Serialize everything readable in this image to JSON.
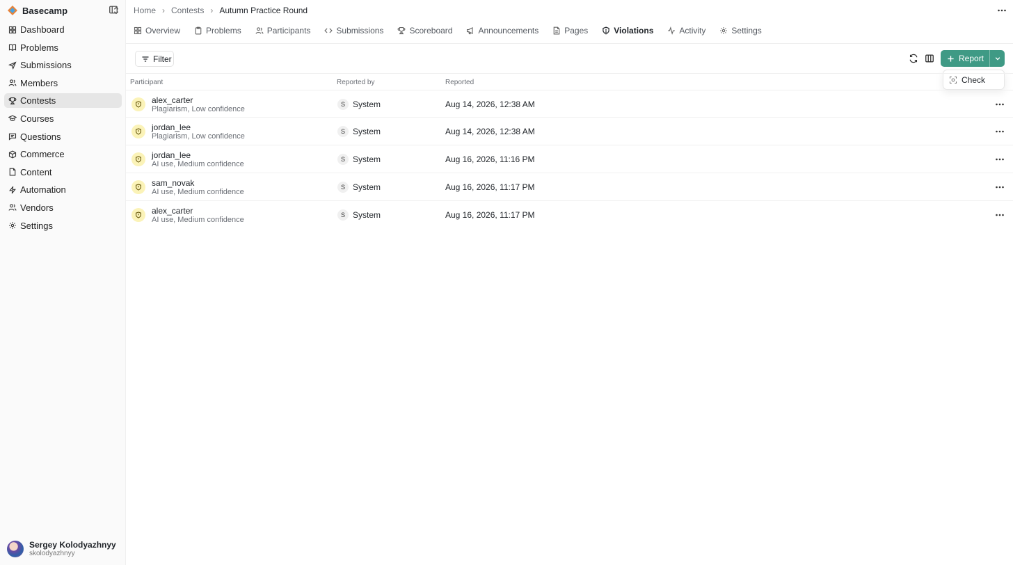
{
  "brand": {
    "name": "Basecamp"
  },
  "sidebar": {
    "items": [
      {
        "label": "Dashboard",
        "icon": "dashboard-icon"
      },
      {
        "label": "Problems",
        "icon": "book-icon"
      },
      {
        "label": "Submissions",
        "icon": "send-icon"
      },
      {
        "label": "Members",
        "icon": "users-icon"
      },
      {
        "label": "Contests",
        "icon": "trophy-icon",
        "active": true
      },
      {
        "label": "Courses",
        "icon": "graduation-cap-icon"
      },
      {
        "label": "Questions",
        "icon": "message-square-icon"
      },
      {
        "label": "Commerce",
        "icon": "package-icon"
      },
      {
        "label": "Content",
        "icon": "file-icon"
      },
      {
        "label": "Automation",
        "icon": "zap-icon"
      },
      {
        "label": "Vendors",
        "icon": "user-group-icon"
      },
      {
        "label": "Settings",
        "icon": "gear-icon"
      }
    ]
  },
  "user": {
    "name": "Sergey Kolodyazhnyy",
    "handle": "skolodyazhnyy"
  },
  "breadcrumb": {
    "home": "Home",
    "contests": "Contests",
    "current": "Autumn Practice Round"
  },
  "tabs": [
    {
      "label": "Overview",
      "icon": "grid-icon"
    },
    {
      "label": "Problems",
      "icon": "clipboard-icon"
    },
    {
      "label": "Participants",
      "icon": "users-icon"
    },
    {
      "label": "Submissions",
      "icon": "code-icon"
    },
    {
      "label": "Scoreboard",
      "icon": "trophy-icon"
    },
    {
      "label": "Announcements",
      "icon": "megaphone-icon"
    },
    {
      "label": "Pages",
      "icon": "file-icon"
    },
    {
      "label": "Violations",
      "icon": "shield-icon",
      "active": true
    },
    {
      "label": "Activity",
      "icon": "activity-icon"
    },
    {
      "label": "Settings",
      "icon": "gear-icon"
    }
  ],
  "toolbar": {
    "filter_label": "Filter",
    "report_label": "Report",
    "dropdown_check_label": "Check"
  },
  "table": {
    "headers": {
      "participant": "Participant",
      "reported_by": "Reported by",
      "reported": "Reported"
    },
    "rows": [
      {
        "participant": "alex_carter",
        "description": "Plagiarism, Low confidence",
        "reporter_initial": "S",
        "reporter": "System",
        "reported": "Aug 14, 2026, 12:38 AM"
      },
      {
        "participant": "jordan_lee",
        "description": "Plagiarism, Low confidence",
        "reporter_initial": "S",
        "reporter": "System",
        "reported": "Aug 14, 2026, 12:38 AM"
      },
      {
        "participant": "jordan_lee",
        "description": "AI use, Medium confidence",
        "reporter_initial": "S",
        "reporter": "System",
        "reported": "Aug 16, 2026, 11:16 PM"
      },
      {
        "participant": "sam_novak",
        "description": "AI use, Medium confidence",
        "reporter_initial": "S",
        "reporter": "System",
        "reported": "Aug 16, 2026, 11:17 PM"
      },
      {
        "participant": "alex_carter",
        "description": "AI use, Medium confidence",
        "reporter_initial": "S",
        "reporter": "System",
        "reported": "Aug 16, 2026, 11:17 PM"
      }
    ]
  },
  "colors": {
    "accent": "#3f9a85",
    "violation_badge": "#fbf3b8",
    "active_nav": "#e6e6e6"
  }
}
